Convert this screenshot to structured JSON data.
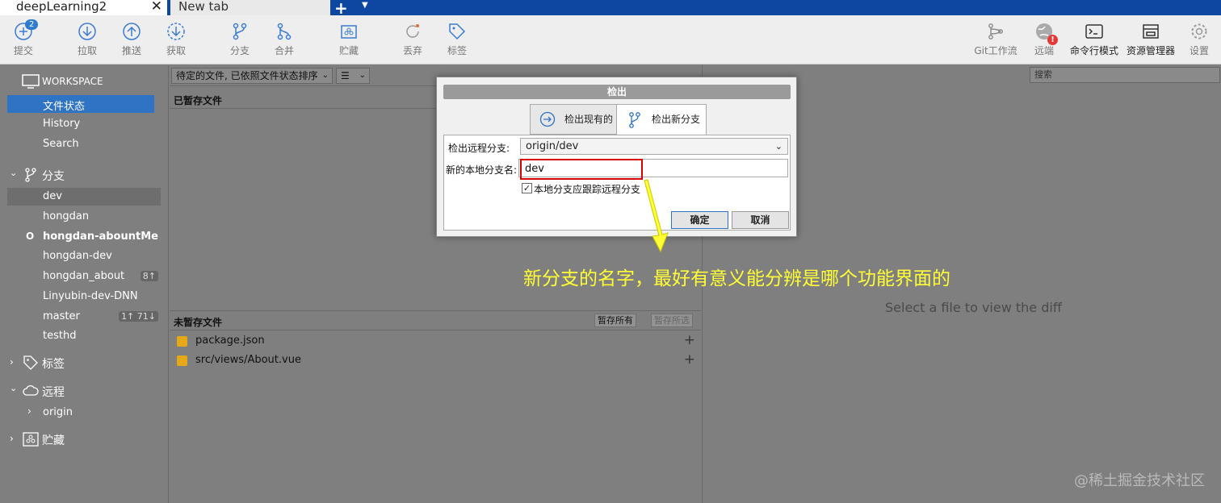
{
  "tabs": {
    "active": "deepLearning2",
    "close": "✕",
    "new_tab": "New tab",
    "plus": "+",
    "dropdown": "▼"
  },
  "toolbar": {
    "commit_badge": "2",
    "commit": "提交",
    "pull": "拉取",
    "push": "推送",
    "fetch": "获取",
    "branch": "分支",
    "merge": "合并",
    "stash": "贮藏",
    "discard": "丢弃",
    "tag": "标签",
    "git_flow": "Git工作流",
    "remote": "远端",
    "terminal": "命令行模式",
    "explorer": "资源管理器",
    "settings": "设置",
    "remote_warning": "!"
  },
  "sidebar": {
    "workspace": "WORKSPACE",
    "file_status": "文件状态",
    "history": "History",
    "search": "Search",
    "branches_header": "分支",
    "branches": [
      "dev",
      "hongdan",
      "hongdan-abountMe",
      "hongdan-dev",
      "hongdan_about",
      "Linyubin-dev-DNN",
      "master",
      "testhd"
    ],
    "current_marker": "O",
    "hongdan_about_count": "8↑",
    "master_count": "1↑ 71↓",
    "tags_header": "标签",
    "remotes_header": "远程",
    "remote_origin": "origin",
    "stashes_header": "贮藏"
  },
  "center": {
    "filter_combo": "待定的文件, 已依照文件状态排序",
    "view_combo": "☰",
    "staged_header": "已暂存文件",
    "unstaged_header": "未暂存文件",
    "stage_all": "暂存所有",
    "stage_selected": "暂存所选",
    "files": [
      "package.json",
      "src/views/About.vue"
    ],
    "plus": "+"
  },
  "right": {
    "search_placeholder": "搜索",
    "hint": "Select a file to view the diff"
  },
  "dialog": {
    "title": "检出",
    "tab_existing": "检出现有的",
    "tab_new": "检出新分支",
    "remote_label": "检出远程分支:",
    "remote_value": "origin/dev",
    "local_label": "新的本地分支名:",
    "local_value": "dev",
    "track_label": "本地分支应跟踪远程分支",
    "check": "✓",
    "ok": "确定",
    "cancel": "取消"
  },
  "annotation": "新分支的名字，最好有意义能分辨是哪个功能界面的",
  "watermark": "@稀土掘金技术社区",
  "colors": {
    "tabbar": "#0d47a1",
    "selection": "#2f73c4",
    "annotation": "#ffff33",
    "highlight_box": "#dd0000"
  }
}
